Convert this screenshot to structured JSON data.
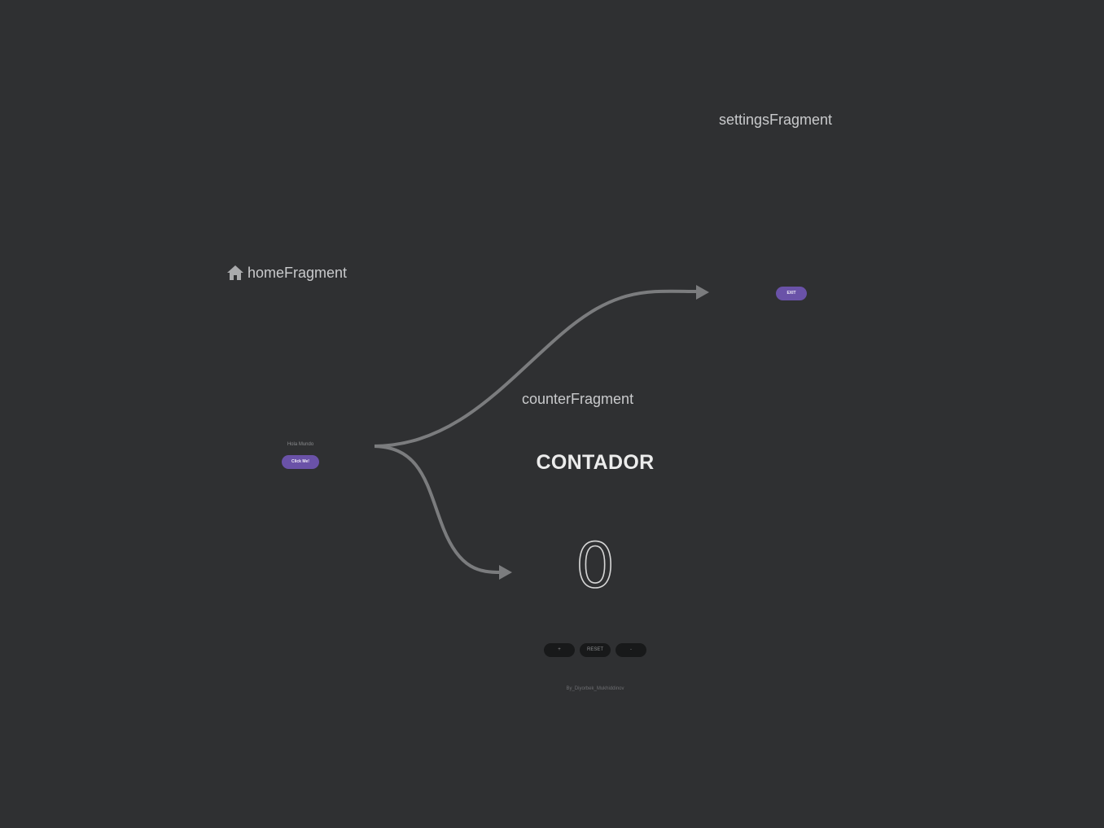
{
  "graph": {
    "home": {
      "title": "homeFragment",
      "start_icon": "home-icon",
      "text": "Hola Mundo",
      "button_label": "Click Me!"
    },
    "counter": {
      "title": "counterFragment",
      "heading": "CONTADOR",
      "count": "0",
      "buttons": [
        "+",
        "RESET",
        "-"
      ],
      "credit": "By_Diyorbek_Mukhiddinov"
    },
    "settings": {
      "title": "settingsFragment",
      "button_label": "EXIT"
    }
  },
  "colors": {
    "background": "#2f3032",
    "accent": "#6a52a8",
    "arrow": "#7b7c7e",
    "label": "#c9cacc"
  }
}
